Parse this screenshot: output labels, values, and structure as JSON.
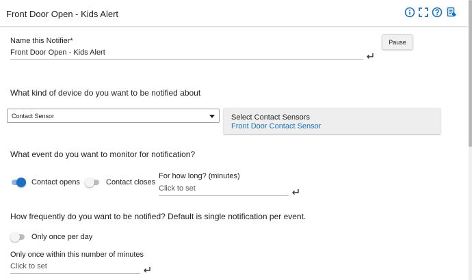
{
  "header": {
    "title": "Front Door Open - Kids Alert",
    "icons": [
      "info-icon",
      "fullscreen-icon",
      "help-icon",
      "document-icon"
    ],
    "icon_color": "#1a6fb8"
  },
  "name_field": {
    "label": "Name this Notifier*",
    "value": "Front Door Open - Kids Alert"
  },
  "pause_button": {
    "label": "Pause"
  },
  "device_section": {
    "question": "What kind of device do you want to be notified about",
    "select_value": "Contact Sensor",
    "panel_title": "Select Contact Sensors",
    "panel_selected": "Front Door Contact Sensor"
  },
  "event_section": {
    "question": "What event do you want to monitor for notification?",
    "contact_opens": {
      "label": "Contact opens",
      "on": true
    },
    "contact_closes": {
      "label": "Contact closes",
      "on": false
    },
    "duration": {
      "label": "For how long? (minutes)",
      "placeholder": "Click to set"
    }
  },
  "frequency_section": {
    "question": "How frequently do you want to be notified?  Default is single notification per event.",
    "once_per_day": {
      "label": "Only once per day",
      "on": false
    },
    "within_minutes": {
      "label": "Only once within this number of minutes",
      "placeholder": "Click to set"
    }
  },
  "colors": {
    "accent": "#1d6fc4",
    "link": "#1a6fb8",
    "panel_bg": "#eeeeee"
  }
}
